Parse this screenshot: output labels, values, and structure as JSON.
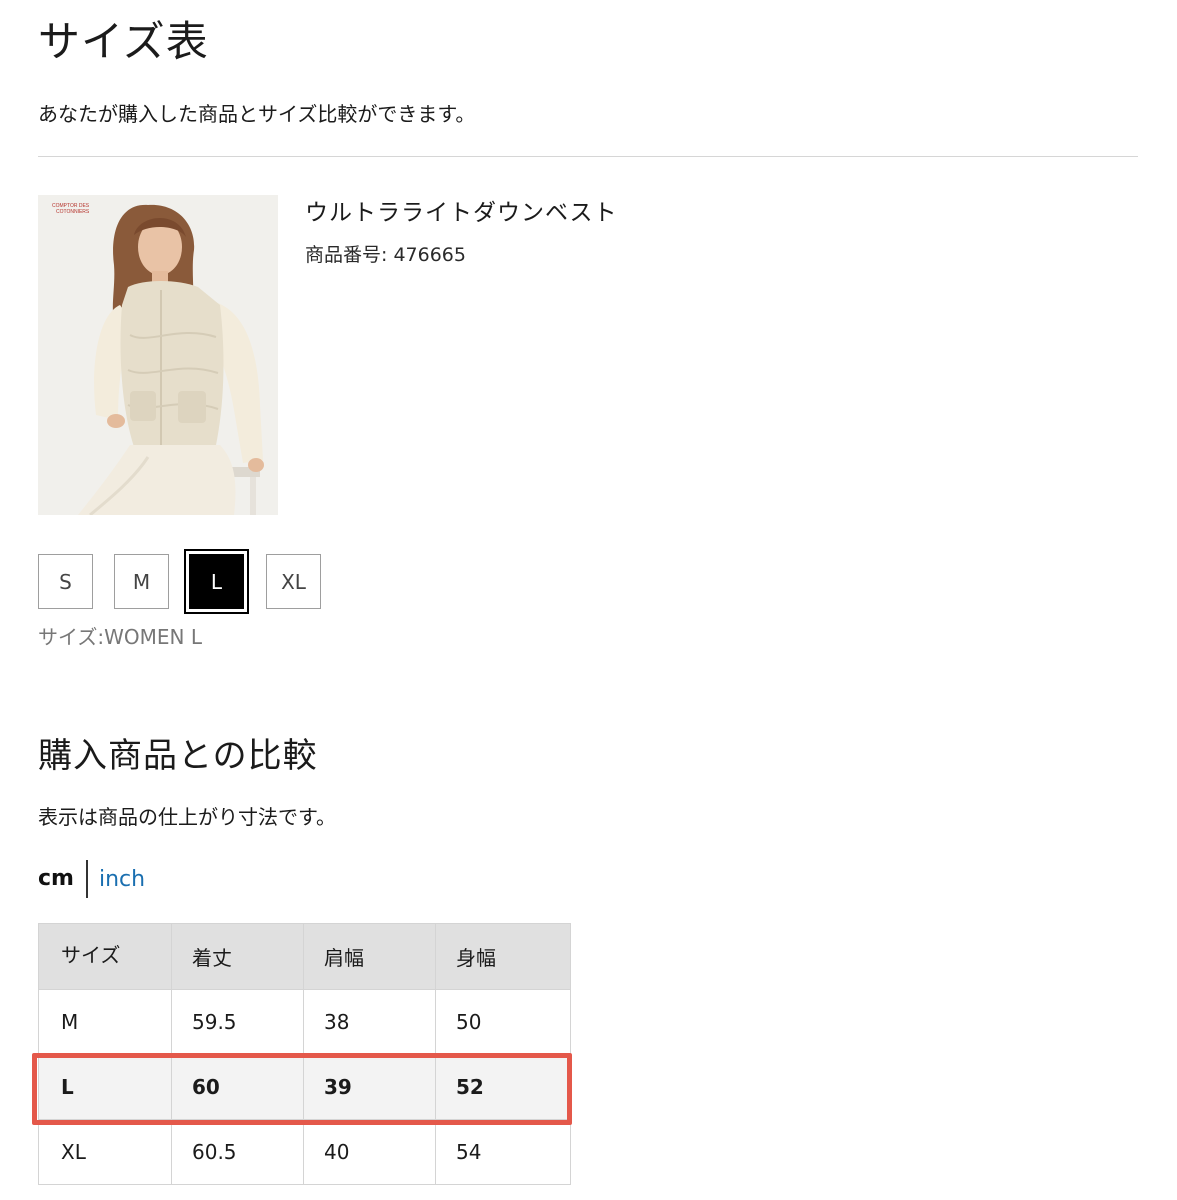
{
  "page": {
    "title": "サイズ表",
    "description": "あなたが購入した商品とサイズ比較ができます。"
  },
  "product": {
    "name": "ウルトラライトダウンベスト",
    "number_label": "商品番号: 476665",
    "image_icon": "product-photo",
    "image_logo_text_line1": "COMPTOR DES",
    "image_logo_text_line2": "COTONNIERS"
  },
  "sizes": {
    "options": [
      "S",
      "M",
      "L",
      "XL"
    ],
    "selected": "L",
    "caption": "サイズ:WOMEN L"
  },
  "comparison": {
    "title": "購入商品との比較",
    "description": "表示は商品の仕上がり寸法です。",
    "units": {
      "active": "cm",
      "alternate": "inch"
    },
    "table": {
      "headers": [
        "サイズ",
        "着丈",
        "肩幅",
        "身幅"
      ],
      "rows": [
        [
          "M",
          "59.5",
          "38",
          "50"
        ],
        [
          "L",
          "60",
          "39",
          "52"
        ],
        [
          "XL",
          "60.5",
          "40",
          "54"
        ]
      ],
      "highlighted_row": "L"
    },
    "highlight_color": "#e4584a"
  },
  "colors": {
    "selected_chip": "#000000",
    "link": "#1a6fb0",
    "header_bg": "#e0e0e0"
  }
}
